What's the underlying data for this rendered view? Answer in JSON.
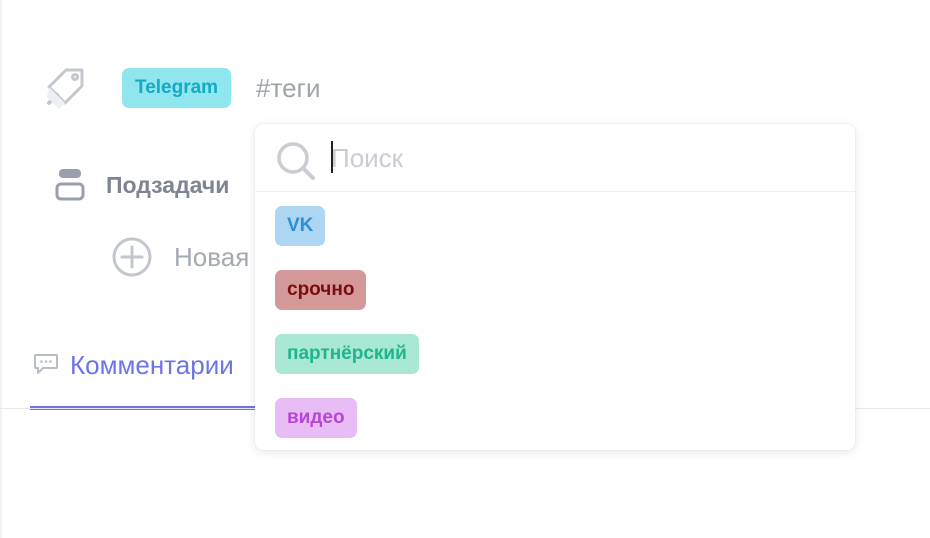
{
  "tags": {
    "selected": [
      {
        "label": "Telegram",
        "bg": "#8fe6ef",
        "fg": "#16a9c4"
      }
    ],
    "placeholder": "#теги"
  },
  "subtasks": {
    "label": "Подзадачи",
    "new_label": "Новая"
  },
  "tabs": {
    "comments_label": "Комментарии",
    "accent": "#6b74e8"
  },
  "dropdown": {
    "search_placeholder": "Поиск",
    "search_value": "",
    "options": [
      {
        "label": "VK",
        "bg": "#add6f2",
        "fg": "#2e8ed8"
      },
      {
        "label": "срочно",
        "bg": "#d49898",
        "fg": "#7a0d10"
      },
      {
        "label": "партнёрский",
        "bg": "#a8e8d5",
        "fg": "#1fb58d"
      },
      {
        "label": "видео",
        "bg": "#e8bcf5",
        "fg": "#b646d4"
      }
    ]
  },
  "icons": {
    "tag": "tag-icon",
    "subtasks": "subtasks-icon",
    "add": "plus-circle-icon",
    "comments": "comment-icon",
    "search": "search-icon"
  }
}
